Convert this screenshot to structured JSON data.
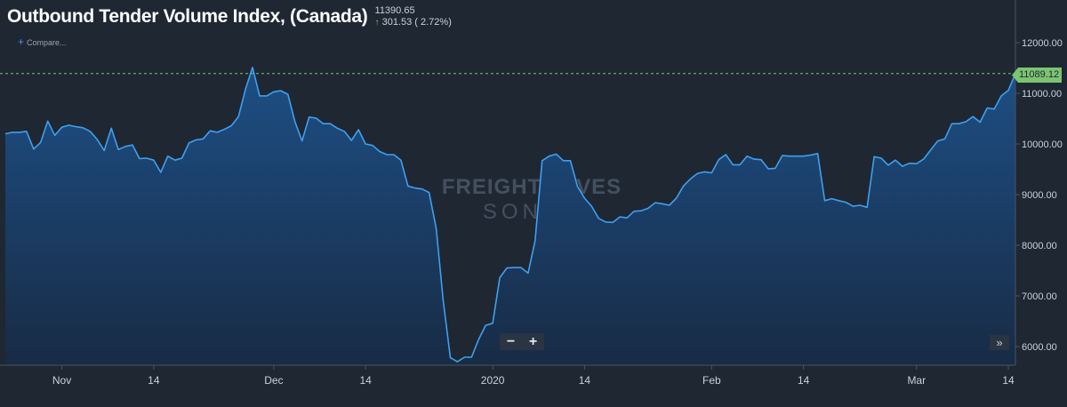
{
  "header": {
    "title": "Outbound Tender Volume Index, (Canada)",
    "last_value": "11390.65",
    "change_arrow": "up-arrow",
    "change": "301.53 ( 2.72%)",
    "compare_label": "Compare..."
  },
  "watermark": {
    "line1": "FREIGHTWAVES",
    "line2": "SONAR"
  },
  "controls": {
    "zoom_out": "−",
    "zoom_in": "+",
    "expand": "»"
  },
  "current_price_tag": "11089.12",
  "colors": {
    "background": "#1f2733",
    "line": "#3ea0f0",
    "area_top": "#1d4f85",
    "area_bottom": "#182b45",
    "reference_line": "#7cc471",
    "price_tag": "#7cc471"
  },
  "chart_data": {
    "type": "area",
    "title": "Outbound Tender Volume Index, (Canada)",
    "xlabel": "",
    "ylabel": "",
    "x_tick_labels": [
      "Nov",
      "14",
      "Dec",
      "14",
      "2020",
      "14",
      "Feb",
      "14",
      "Mar",
      "14"
    ],
    "x_tick_dates": [
      "2019-11-01",
      "2019-11-14",
      "2019-12-01",
      "2019-12-14",
      "2020-01-01",
      "2020-01-14",
      "2020-02-01",
      "2020-02-14",
      "2020-03-01",
      "2020-03-14"
    ],
    "y_tick_labels": [
      "6000.00",
      "7000.00",
      "8000.00",
      "9000.00",
      "10000.00",
      "11000.00",
      "12000.00"
    ],
    "ylim": [
      5600,
      12900
    ],
    "xlim": [
      "2019-10-24",
      "2020-03-15"
    ],
    "grid": false,
    "reference_line_value": 11390.65,
    "series": [
      {
        "values": [
          [
            "2019-10-24",
            10200
          ],
          [
            "2019-10-25",
            10230
          ],
          [
            "2019-10-26",
            10230
          ],
          [
            "2019-10-27",
            10250
          ],
          [
            "2019-10-28",
            9900
          ],
          [
            "2019-10-29",
            10030
          ],
          [
            "2019-10-30",
            10450
          ],
          [
            "2019-10-31",
            10170
          ],
          [
            "2019-11-01",
            10330
          ],
          [
            "2019-11-02",
            10370
          ],
          [
            "2019-11-03",
            10340
          ],
          [
            "2019-11-04",
            10320
          ],
          [
            "2019-11-05",
            10250
          ],
          [
            "2019-11-06",
            10090
          ],
          [
            "2019-11-07",
            9870
          ],
          [
            "2019-11-08",
            10310
          ],
          [
            "2019-11-09",
            9890
          ],
          [
            "2019-11-10",
            9950
          ],
          [
            "2019-11-11",
            9980
          ],
          [
            "2019-11-12",
            9710
          ],
          [
            "2019-11-13",
            9720
          ],
          [
            "2019-11-14",
            9680
          ],
          [
            "2019-11-15",
            9440
          ],
          [
            "2019-11-16",
            9760
          ],
          [
            "2019-11-17",
            9680
          ],
          [
            "2019-11-18",
            9720
          ],
          [
            "2019-11-19",
            10020
          ],
          [
            "2019-11-20",
            10080
          ],
          [
            "2019-11-21",
            10100
          ],
          [
            "2019-11-22",
            10260
          ],
          [
            "2019-11-23",
            10230
          ],
          [
            "2019-11-24",
            10290
          ],
          [
            "2019-11-25",
            10360
          ],
          [
            "2019-11-26",
            10540
          ],
          [
            "2019-11-27",
            11080
          ],
          [
            "2019-11-28",
            11510
          ],
          [
            "2019-11-29",
            10950
          ],
          [
            "2019-11-30",
            10950
          ],
          [
            "2019-12-01",
            11030
          ],
          [
            "2019-12-02",
            11050
          ],
          [
            "2019-12-03",
            10980
          ],
          [
            "2019-12-04",
            10440
          ],
          [
            "2019-12-05",
            10060
          ],
          [
            "2019-12-06",
            10530
          ],
          [
            "2019-12-07",
            10510
          ],
          [
            "2019-12-08",
            10400
          ],
          [
            "2019-12-09",
            10400
          ],
          [
            "2019-12-10",
            10310
          ],
          [
            "2019-12-11",
            10250
          ],
          [
            "2019-12-12",
            10070
          ],
          [
            "2019-12-13",
            10280
          ],
          [
            "2019-12-14",
            10000
          ],
          [
            "2019-12-15",
            9970
          ],
          [
            "2019-12-16",
            9850
          ],
          [
            "2019-12-17",
            9790
          ],
          [
            "2019-12-18",
            9790
          ],
          [
            "2019-12-19",
            9680
          ],
          [
            "2019-12-20",
            9170
          ],
          [
            "2019-12-21",
            9130
          ],
          [
            "2019-12-22",
            9110
          ],
          [
            "2019-12-23",
            9040
          ],
          [
            "2019-12-24",
            8330
          ],
          [
            "2019-12-25",
            6900
          ],
          [
            "2019-12-26",
            5780
          ],
          [
            "2019-12-27",
            5700
          ],
          [
            "2019-12-28",
            5790
          ],
          [
            "2019-12-29",
            5790
          ],
          [
            "2019-12-30",
            6140
          ],
          [
            "2019-12-31",
            6420
          ],
          [
            "2020-01-01",
            6460
          ],
          [
            "2020-01-02",
            7360
          ],
          [
            "2020-01-03",
            7550
          ],
          [
            "2020-01-04",
            7560
          ],
          [
            "2020-01-05",
            7560
          ],
          [
            "2020-01-06",
            7450
          ],
          [
            "2020-01-07",
            8090
          ],
          [
            "2020-01-08",
            9670
          ],
          [
            "2020-01-09",
            9760
          ],
          [
            "2020-01-10",
            9800
          ],
          [
            "2020-01-11",
            9670
          ],
          [
            "2020-01-12",
            9670
          ],
          [
            "2020-01-13",
            9160
          ],
          [
            "2020-01-14",
            8930
          ],
          [
            "2020-01-15",
            8770
          ],
          [
            "2020-01-16",
            8530
          ],
          [
            "2020-01-17",
            8460
          ],
          [
            "2020-01-18",
            8450
          ],
          [
            "2020-01-19",
            8560
          ],
          [
            "2020-01-20",
            8540
          ],
          [
            "2020-01-21",
            8670
          ],
          [
            "2020-01-22",
            8680
          ],
          [
            "2020-01-23",
            8730
          ],
          [
            "2020-01-24",
            8840
          ],
          [
            "2020-01-25",
            8820
          ],
          [
            "2020-01-26",
            8790
          ],
          [
            "2020-01-27",
            8930
          ],
          [
            "2020-01-28",
            9170
          ],
          [
            "2020-01-29",
            9310
          ],
          [
            "2020-01-30",
            9420
          ],
          [
            "2020-01-31",
            9450
          ],
          [
            "2020-02-01",
            9430
          ],
          [
            "2020-02-02",
            9690
          ],
          [
            "2020-02-03",
            9790
          ],
          [
            "2020-02-04",
            9590
          ],
          [
            "2020-02-05",
            9590
          ],
          [
            "2020-02-06",
            9760
          ],
          [
            "2020-02-07",
            9700
          ],
          [
            "2020-02-08",
            9690
          ],
          [
            "2020-02-09",
            9510
          ],
          [
            "2020-02-10",
            9520
          ],
          [
            "2020-02-11",
            9770
          ],
          [
            "2020-02-12",
            9760
          ],
          [
            "2020-02-13",
            9760
          ],
          [
            "2020-02-14",
            9760
          ],
          [
            "2020-02-15",
            9780
          ],
          [
            "2020-02-16",
            9810
          ],
          [
            "2020-02-17",
            8880
          ],
          [
            "2020-02-18",
            8920
          ],
          [
            "2020-02-19",
            8880
          ],
          [
            "2020-02-20",
            8850
          ],
          [
            "2020-02-21",
            8770
          ],
          [
            "2020-02-22",
            8790
          ],
          [
            "2020-02-23",
            8750
          ],
          [
            "2020-02-24",
            9750
          ],
          [
            "2020-02-25",
            9720
          ],
          [
            "2020-02-26",
            9580
          ],
          [
            "2020-02-27",
            9680
          ],
          [
            "2020-02-28",
            9560
          ],
          [
            "2020-02-29",
            9620
          ],
          [
            "2020-03-01",
            9610
          ],
          [
            "2020-03-02",
            9700
          ],
          [
            "2020-03-03",
            9880
          ],
          [
            "2020-03-04",
            10060
          ],
          [
            "2020-03-05",
            10100
          ],
          [
            "2020-03-06",
            10400
          ],
          [
            "2020-03-07",
            10400
          ],
          [
            "2020-03-08",
            10440
          ],
          [
            "2020-03-09",
            10540
          ],
          [
            "2020-03-10",
            10430
          ],
          [
            "2020-03-11",
            10710
          ],
          [
            "2020-03-12",
            10690
          ],
          [
            "2020-03-13",
            10950
          ],
          [
            "2020-03-14",
            11060
          ],
          [
            "2020-03-15",
            11390
          ]
        ]
      }
    ]
  }
}
